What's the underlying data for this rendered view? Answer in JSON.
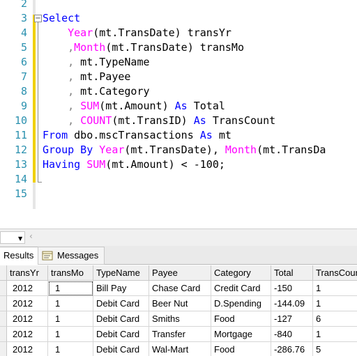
{
  "editor": {
    "lines": [
      {
        "n": "2",
        "segments": []
      },
      {
        "n": "3",
        "segments": [
          {
            "t": "Select",
            "c": "kw"
          }
        ]
      },
      {
        "n": "4",
        "segments": [
          {
            "t": "    "
          },
          {
            "t": "Year",
            "c": "fn"
          },
          {
            "t": "(mt.TransDate) transYr"
          }
        ]
      },
      {
        "n": "5",
        "segments": [
          {
            "t": "    "
          },
          {
            "t": ",",
            "c": "gr"
          },
          {
            "t": "Month",
            "c": "fn"
          },
          {
            "t": "(mt.TransDate) transMo"
          }
        ]
      },
      {
        "n": "6",
        "segments": [
          {
            "t": "    "
          },
          {
            "t": ",",
            "c": "gr"
          },
          {
            "t": " mt.TypeName"
          }
        ]
      },
      {
        "n": "7",
        "segments": [
          {
            "t": "    "
          },
          {
            "t": ",",
            "c": "gr"
          },
          {
            "t": " mt.Payee"
          }
        ]
      },
      {
        "n": "8",
        "segments": [
          {
            "t": "    "
          },
          {
            "t": ",",
            "c": "gr"
          },
          {
            "t": " mt.Category"
          }
        ]
      },
      {
        "n": "9",
        "segments": [
          {
            "t": "    "
          },
          {
            "t": ",",
            "c": "gr"
          },
          {
            "t": " "
          },
          {
            "t": "SUM",
            "c": "fn"
          },
          {
            "t": "(mt.Amount) "
          },
          {
            "t": "As",
            "c": "kw"
          },
          {
            "t": " Total"
          }
        ]
      },
      {
        "n": "10",
        "segments": [
          {
            "t": "    "
          },
          {
            "t": ",",
            "c": "gr"
          },
          {
            "t": " "
          },
          {
            "t": "COUNT",
            "c": "fn"
          },
          {
            "t": "(mt.TransID) "
          },
          {
            "t": "As",
            "c": "kw"
          },
          {
            "t": " TransCount"
          }
        ]
      },
      {
        "n": "11",
        "segments": [
          {
            "t": "From",
            "c": "kw"
          },
          {
            "t": " dbo.mscTransactions "
          },
          {
            "t": "As",
            "c": "kw"
          },
          {
            "t": " mt"
          }
        ]
      },
      {
        "n": "12",
        "segments": [
          {
            "t": "Group By",
            "c": "kw"
          },
          {
            "t": " "
          },
          {
            "t": "Year",
            "c": "fn"
          },
          {
            "t": "(mt.TransDate), "
          },
          {
            "t": "Month",
            "c": "fn"
          },
          {
            "t": "(mt.TransDa"
          }
        ]
      },
      {
        "n": "13",
        "segments": [
          {
            "t": "Having",
            "c": "kw"
          },
          {
            "t": " "
          },
          {
            "t": "SUM",
            "c": "fn"
          },
          {
            "t": "(mt.Amount) < -100;"
          }
        ]
      },
      {
        "n": "14",
        "segments": []
      },
      {
        "n": "15",
        "segments": []
      }
    ]
  },
  "toolbar": {
    "combo_value": "",
    "scroll_left_icon": "chevron-left-icon"
  },
  "results_tabs": {
    "results_label": "Results",
    "messages_label": "Messages"
  },
  "grid": {
    "columns": [
      "transYr",
      "transMo",
      "TypeName",
      "Payee",
      "Category",
      "Total",
      "TransCount"
    ],
    "rows": [
      [
        "2012",
        "1",
        "Bill Pay",
        "Chase Card",
        "Credit Card",
        "-150",
        "1"
      ],
      [
        "2012",
        "1",
        "Debit Card",
        "Beer Nut",
        "D.Spending",
        "-144.09",
        "1"
      ],
      [
        "2012",
        "1",
        "Debit Card",
        "Smiths",
        "Food",
        "-127",
        "6"
      ],
      [
        "2012",
        "1",
        "Debit Card",
        "Transfer",
        "Mortgage",
        "-840",
        "1"
      ],
      [
        "2012",
        "1",
        "Debit Card",
        "Wal-Mart",
        "Food",
        "-286.76",
        "5"
      ]
    ]
  },
  "colors": {
    "keyword": "#0000ff",
    "function": "#ff00ff",
    "operator": "#808080",
    "line_number": "#2b91af"
  }
}
